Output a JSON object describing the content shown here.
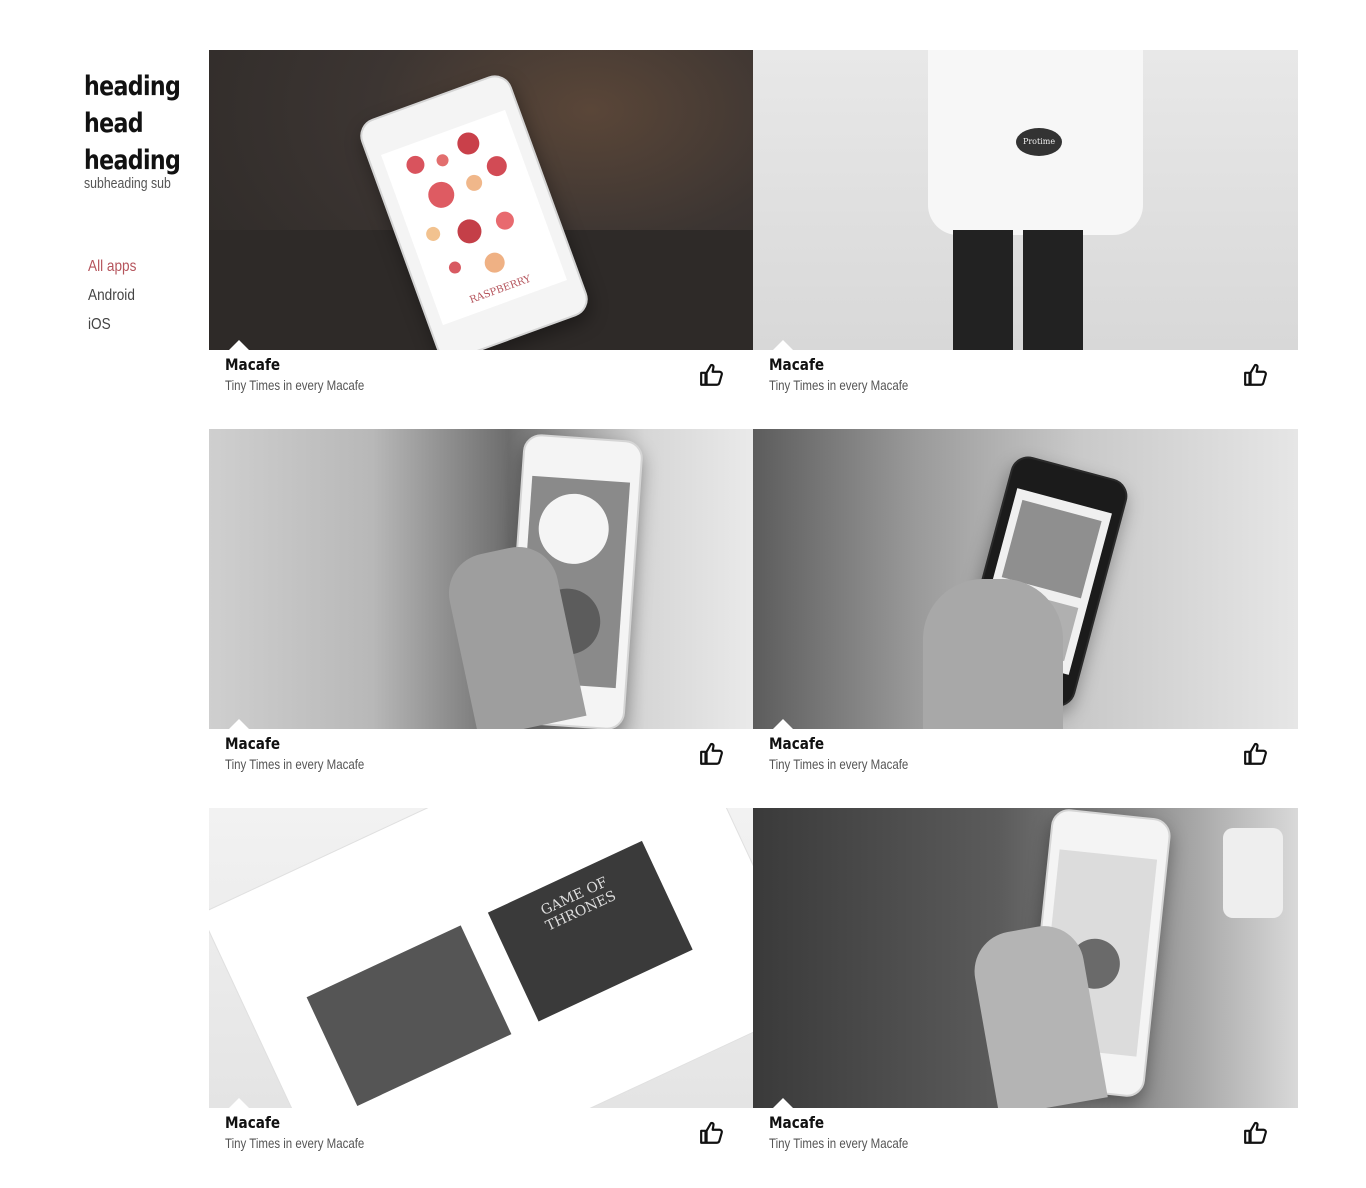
{
  "sidebar": {
    "title_lines": [
      "heading",
      "head",
      "heading"
    ],
    "subtitle": "subheading sub",
    "filters": [
      {
        "label": "All apps",
        "active": true
      },
      {
        "label": "Android",
        "active": false
      },
      {
        "label": "iOS",
        "active": false
      }
    ],
    "active_color": "#b5545c"
  },
  "cards": [
    {
      "title": "Macafe",
      "description": "Tiny Times in every Macafe",
      "image_overlay_text": "RASPBERRY",
      "like_icon": "thumbs-up-icon"
    },
    {
      "title": "Macafe",
      "description": "Tiny Times in every Macafe",
      "image_overlay_text": "Protime",
      "like_icon": "thumbs-up-icon"
    },
    {
      "title": "Macafe",
      "description": "Tiny Times in every Macafe",
      "like_icon": "thumbs-up-icon"
    },
    {
      "title": "Macafe",
      "description": "Tiny Times in every Macafe",
      "like_icon": "thumbs-up-icon"
    },
    {
      "title": "Macafe",
      "description": "Tiny Times in every Macafe",
      "image_overlay_text": "GAME OF THRONES",
      "like_icon": "thumbs-up-icon"
    },
    {
      "title": "Macafe",
      "description": "Tiny Times in every Macafe",
      "like_icon": "thumbs-up-icon"
    }
  ]
}
